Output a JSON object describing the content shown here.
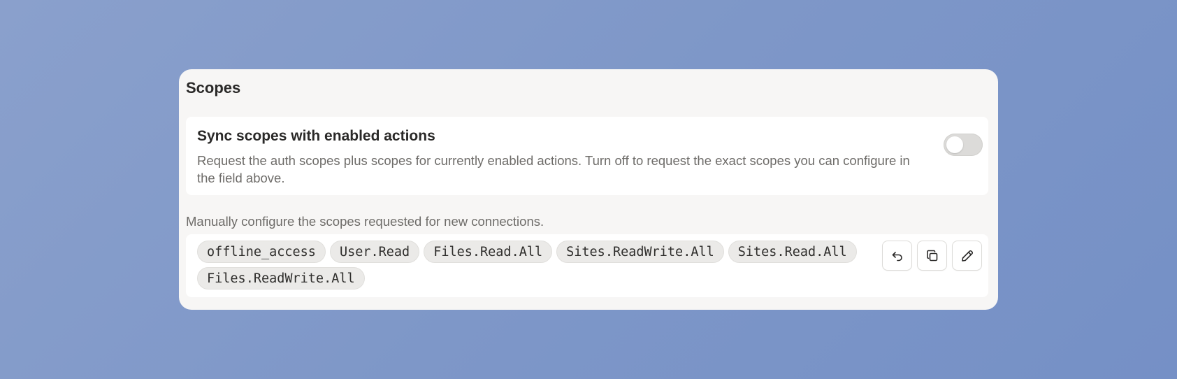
{
  "card": {
    "title": "Scopes"
  },
  "sync": {
    "title": "Sync scopes with enabled actions",
    "description": "Request the auth scopes plus scopes for currently enabled actions. Turn off to request the exact scopes you can configure in the field above.",
    "enabled": false
  },
  "manual": {
    "label": "Manually configure the scopes requested for new connections."
  },
  "scopes": [
    "offline_access",
    "User.Read",
    "Files.Read.All",
    "Sites.ReadWrite.All",
    "Sites.Read.All",
    "Files.ReadWrite.All"
  ],
  "actions": [
    {
      "icon": "undo-icon"
    },
    {
      "icon": "copy-icon"
    },
    {
      "icon": "pencil-icon"
    }
  ]
}
